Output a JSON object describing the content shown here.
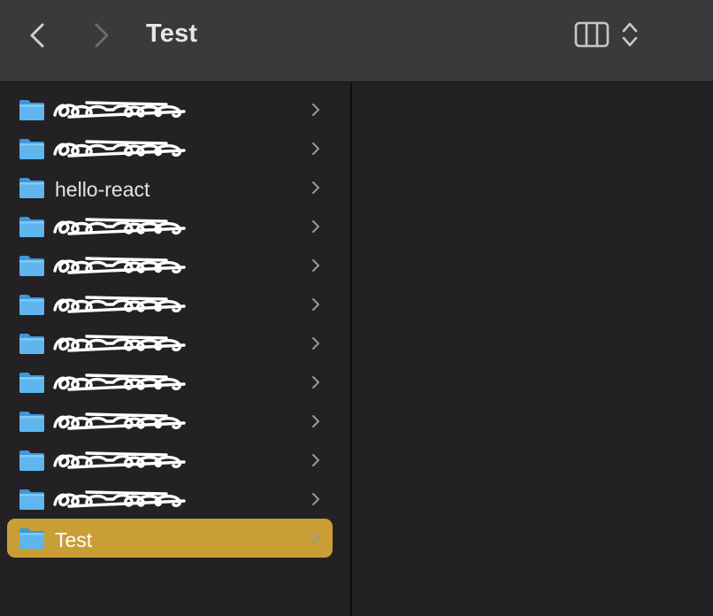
{
  "window": {
    "title": "Test"
  },
  "toolbar": {
    "back_icon": "chevron-left-icon",
    "forward_icon": "chevron-right-icon",
    "view_icon": "columns-view-icon",
    "view_stepper_icon": "up-down-chevron-icon"
  },
  "colors": {
    "toolbar_bg": "#3b393c",
    "column_bg": "#232124",
    "selection": "#c99e35",
    "folder_blue": "#5fb5ee"
  },
  "column": {
    "items": [
      {
        "label": "",
        "redacted": true,
        "selected": false
      },
      {
        "label": "",
        "redacted": true,
        "selected": false
      },
      {
        "label": "hello-react",
        "redacted": false,
        "selected": false
      },
      {
        "label": "",
        "redacted": true,
        "selected": false
      },
      {
        "label": "",
        "redacted": true,
        "selected": false
      },
      {
        "label": "",
        "redacted": true,
        "selected": false
      },
      {
        "label": "",
        "redacted": true,
        "selected": false
      },
      {
        "label": "",
        "redacted": true,
        "selected": false
      },
      {
        "label": "",
        "redacted": true,
        "selected": false
      },
      {
        "label": "",
        "redacted": true,
        "selected": false
      },
      {
        "label": "",
        "redacted": true,
        "selected": false
      },
      {
        "label": "Test",
        "redacted": false,
        "selected": true
      }
    ]
  }
}
